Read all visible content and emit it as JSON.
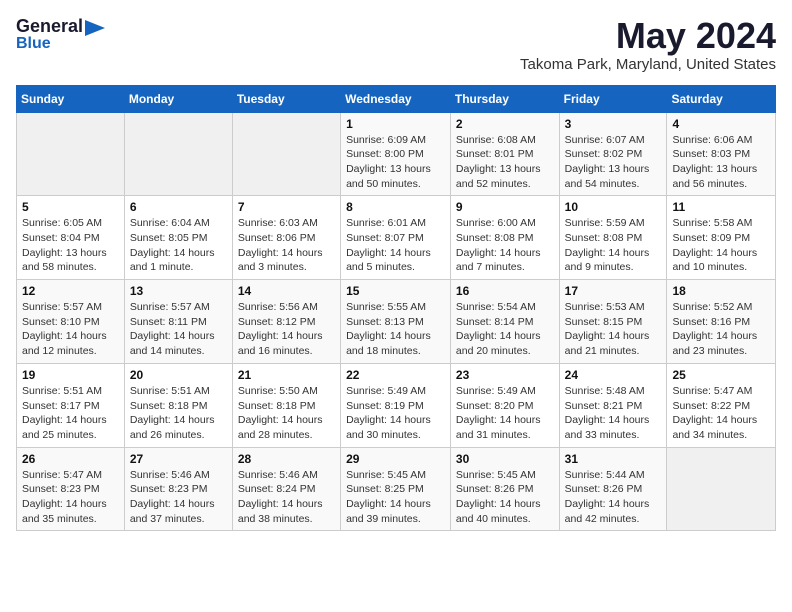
{
  "logo": {
    "general": "General",
    "blue": "Blue",
    "icon": "▶"
  },
  "title": "May 2024",
  "location": "Takoma Park, Maryland, United States",
  "weekdays": [
    "Sunday",
    "Monday",
    "Tuesday",
    "Wednesday",
    "Thursday",
    "Friday",
    "Saturday"
  ],
  "weeks": [
    [
      {
        "day": "",
        "info": ""
      },
      {
        "day": "",
        "info": ""
      },
      {
        "day": "",
        "info": ""
      },
      {
        "day": "1",
        "info": "Sunrise: 6:09 AM\nSunset: 8:00 PM\nDaylight: 13 hours and 50 minutes."
      },
      {
        "day": "2",
        "info": "Sunrise: 6:08 AM\nSunset: 8:01 PM\nDaylight: 13 hours and 52 minutes."
      },
      {
        "day": "3",
        "info": "Sunrise: 6:07 AM\nSunset: 8:02 PM\nDaylight: 13 hours and 54 minutes."
      },
      {
        "day": "4",
        "info": "Sunrise: 6:06 AM\nSunset: 8:03 PM\nDaylight: 13 hours and 56 minutes."
      }
    ],
    [
      {
        "day": "5",
        "info": "Sunrise: 6:05 AM\nSunset: 8:04 PM\nDaylight: 13 hours and 58 minutes."
      },
      {
        "day": "6",
        "info": "Sunrise: 6:04 AM\nSunset: 8:05 PM\nDaylight: 14 hours and 1 minute."
      },
      {
        "day": "7",
        "info": "Sunrise: 6:03 AM\nSunset: 8:06 PM\nDaylight: 14 hours and 3 minutes."
      },
      {
        "day": "8",
        "info": "Sunrise: 6:01 AM\nSunset: 8:07 PM\nDaylight: 14 hours and 5 minutes."
      },
      {
        "day": "9",
        "info": "Sunrise: 6:00 AM\nSunset: 8:08 PM\nDaylight: 14 hours and 7 minutes."
      },
      {
        "day": "10",
        "info": "Sunrise: 5:59 AM\nSunset: 8:08 PM\nDaylight: 14 hours and 9 minutes."
      },
      {
        "day": "11",
        "info": "Sunrise: 5:58 AM\nSunset: 8:09 PM\nDaylight: 14 hours and 10 minutes."
      }
    ],
    [
      {
        "day": "12",
        "info": "Sunrise: 5:57 AM\nSunset: 8:10 PM\nDaylight: 14 hours and 12 minutes."
      },
      {
        "day": "13",
        "info": "Sunrise: 5:57 AM\nSunset: 8:11 PM\nDaylight: 14 hours and 14 minutes."
      },
      {
        "day": "14",
        "info": "Sunrise: 5:56 AM\nSunset: 8:12 PM\nDaylight: 14 hours and 16 minutes."
      },
      {
        "day": "15",
        "info": "Sunrise: 5:55 AM\nSunset: 8:13 PM\nDaylight: 14 hours and 18 minutes."
      },
      {
        "day": "16",
        "info": "Sunrise: 5:54 AM\nSunset: 8:14 PM\nDaylight: 14 hours and 20 minutes."
      },
      {
        "day": "17",
        "info": "Sunrise: 5:53 AM\nSunset: 8:15 PM\nDaylight: 14 hours and 21 minutes."
      },
      {
        "day": "18",
        "info": "Sunrise: 5:52 AM\nSunset: 8:16 PM\nDaylight: 14 hours and 23 minutes."
      }
    ],
    [
      {
        "day": "19",
        "info": "Sunrise: 5:51 AM\nSunset: 8:17 PM\nDaylight: 14 hours and 25 minutes."
      },
      {
        "day": "20",
        "info": "Sunrise: 5:51 AM\nSunset: 8:18 PM\nDaylight: 14 hours and 26 minutes."
      },
      {
        "day": "21",
        "info": "Sunrise: 5:50 AM\nSunset: 8:18 PM\nDaylight: 14 hours and 28 minutes."
      },
      {
        "day": "22",
        "info": "Sunrise: 5:49 AM\nSunset: 8:19 PM\nDaylight: 14 hours and 30 minutes."
      },
      {
        "day": "23",
        "info": "Sunrise: 5:49 AM\nSunset: 8:20 PM\nDaylight: 14 hours and 31 minutes."
      },
      {
        "day": "24",
        "info": "Sunrise: 5:48 AM\nSunset: 8:21 PM\nDaylight: 14 hours and 33 minutes."
      },
      {
        "day": "25",
        "info": "Sunrise: 5:47 AM\nSunset: 8:22 PM\nDaylight: 14 hours and 34 minutes."
      }
    ],
    [
      {
        "day": "26",
        "info": "Sunrise: 5:47 AM\nSunset: 8:23 PM\nDaylight: 14 hours and 35 minutes."
      },
      {
        "day": "27",
        "info": "Sunrise: 5:46 AM\nSunset: 8:23 PM\nDaylight: 14 hours and 37 minutes."
      },
      {
        "day": "28",
        "info": "Sunrise: 5:46 AM\nSunset: 8:24 PM\nDaylight: 14 hours and 38 minutes."
      },
      {
        "day": "29",
        "info": "Sunrise: 5:45 AM\nSunset: 8:25 PM\nDaylight: 14 hours and 39 minutes."
      },
      {
        "day": "30",
        "info": "Sunrise: 5:45 AM\nSunset: 8:26 PM\nDaylight: 14 hours and 40 minutes."
      },
      {
        "day": "31",
        "info": "Sunrise: 5:44 AM\nSunset: 8:26 PM\nDaylight: 14 hours and 42 minutes."
      },
      {
        "day": "",
        "info": ""
      }
    ]
  ]
}
